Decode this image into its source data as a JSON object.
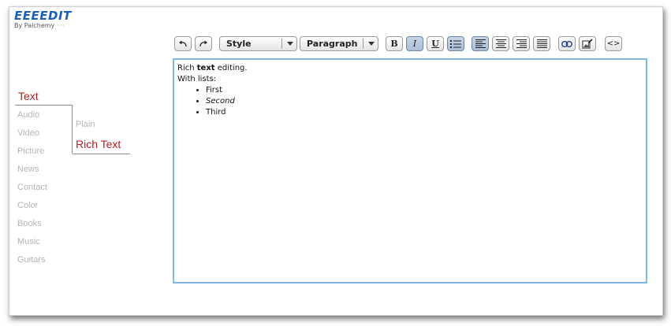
{
  "app": {
    "title": "EEEEDIT",
    "byline": "By Palchemy",
    "byline_dots": "···"
  },
  "nav": {
    "items": [
      "Text",
      "Audio",
      "Video",
      "Picture",
      "News",
      "Contact",
      "Color",
      "Books",
      "Music",
      "Guitars"
    ],
    "active_index": 0,
    "sub_items": [
      "Plain",
      "Rich Text"
    ],
    "active_sub_index": 1
  },
  "toolbar": {
    "undo_icon": "undo-icon",
    "redo_icon": "redo-icon",
    "style_dropdown": {
      "value": "Style"
    },
    "format_dropdown": {
      "value": "Paragraph"
    },
    "bold_label": "B",
    "italic_label": "I",
    "underline_label": "U",
    "pressed": [
      "italic",
      "bullet-list",
      "align-left"
    ],
    "source_label": "<>"
  },
  "editor": {
    "line1_before": "Rich ",
    "line1_bold": "text",
    "line1_after": " editing.",
    "line2": "With lists:",
    "list_items": [
      "First",
      "Second",
      "Third"
    ],
    "italic_item_index": 1
  },
  "colors": {
    "brand": "#1a5fb4",
    "active_nav": "#b22222",
    "inactive_nav": "#b5b5b5",
    "editor_border": "#7cb8e2"
  }
}
